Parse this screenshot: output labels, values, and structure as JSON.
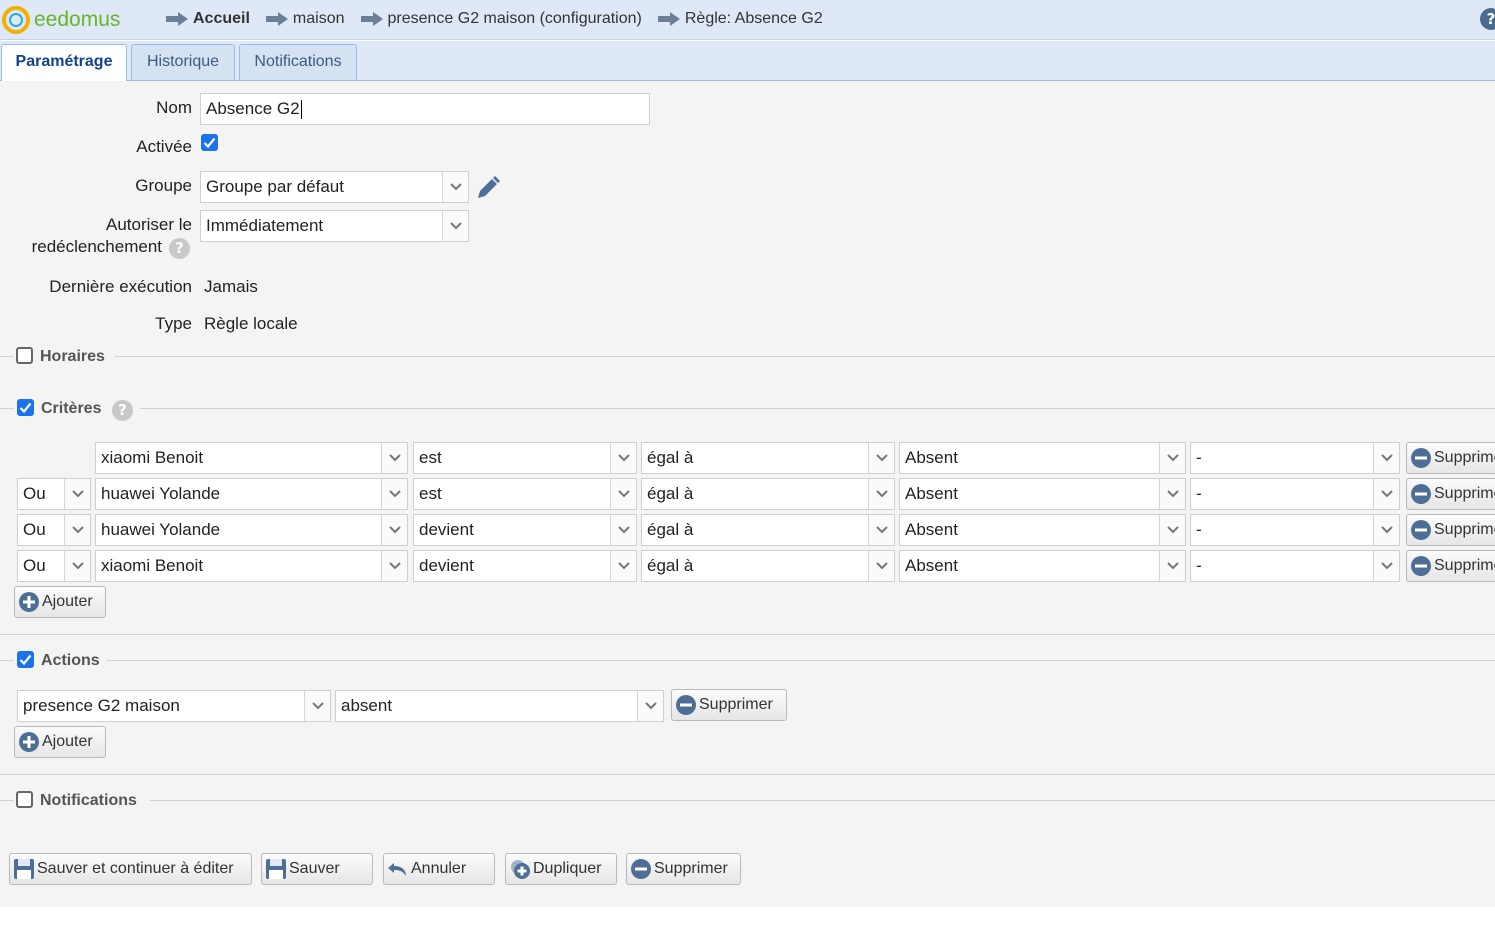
{
  "header": {
    "logo_text": "eedomus",
    "breadcrumb": [
      "Accueil",
      "maison",
      "presence G2 maison (configuration)",
      "Règle: Absence G2"
    ],
    "help_glyph": "?"
  },
  "tabs": [
    {
      "label": "Paramétrage",
      "active": true
    },
    {
      "label": "Historique",
      "active": false
    },
    {
      "label": "Notifications",
      "active": false
    }
  ],
  "form": {
    "name_label": "Nom",
    "name_value": "Absence G2",
    "active_label": "Activée",
    "active_checked": true,
    "group_label": "Groupe",
    "group_value": "Groupe par défaut",
    "retrigger_label_1": "Autoriser le",
    "retrigger_label_2": "redéclenchement",
    "retrigger_value": "Immédiatement",
    "last_exec_label": "Dernière exécution",
    "last_exec_value": "Jamais",
    "type_label": "Type",
    "type_value": "Règle locale"
  },
  "sections": {
    "schedules": {
      "label": "Horaires",
      "checked": false
    },
    "criteria": {
      "label": "Critères",
      "checked": true
    },
    "actions": {
      "label": "Actions",
      "checked": true
    },
    "notifications": {
      "label": "Notifications",
      "checked": false
    }
  },
  "criteria_rows": [
    {
      "connector": "",
      "device": "xiaomi Benoit",
      "verb": "est",
      "comparator": "égal à",
      "value": "Absent",
      "extra": "-",
      "delete_label": "Supprimer"
    },
    {
      "connector": "Ou",
      "device": "huawei Yolande",
      "verb": "est",
      "comparator": "égal à",
      "value": "Absent",
      "extra": "-",
      "delete_label": "Supprimer"
    },
    {
      "connector": "Ou",
      "device": "huawei Yolande",
      "verb": "devient",
      "comparator": "égal à",
      "value": "Absent",
      "extra": "-",
      "delete_label": "Supprimer"
    },
    {
      "connector": "Ou",
      "device": "xiaomi Benoit",
      "verb": "devient",
      "comparator": "égal à",
      "value": "Absent",
      "extra": "-",
      "delete_label": "Supprimer"
    }
  ],
  "criteria_add_label": "Ajouter",
  "action_rows": [
    {
      "device": "presence G2 maison",
      "value": "absent",
      "delete_label": "Supprimer"
    }
  ],
  "actions_add_label": "Ajouter",
  "footer": {
    "save_continue": "Sauver et continuer à éditer",
    "save": "Sauver",
    "cancel": "Annuler",
    "duplicate": "Dupliquer",
    "delete": "Supprimer"
  },
  "colors": {
    "accent": "#15428b",
    "header_bg": "#dfe8f6",
    "check_blue": "#1a73e8"
  }
}
